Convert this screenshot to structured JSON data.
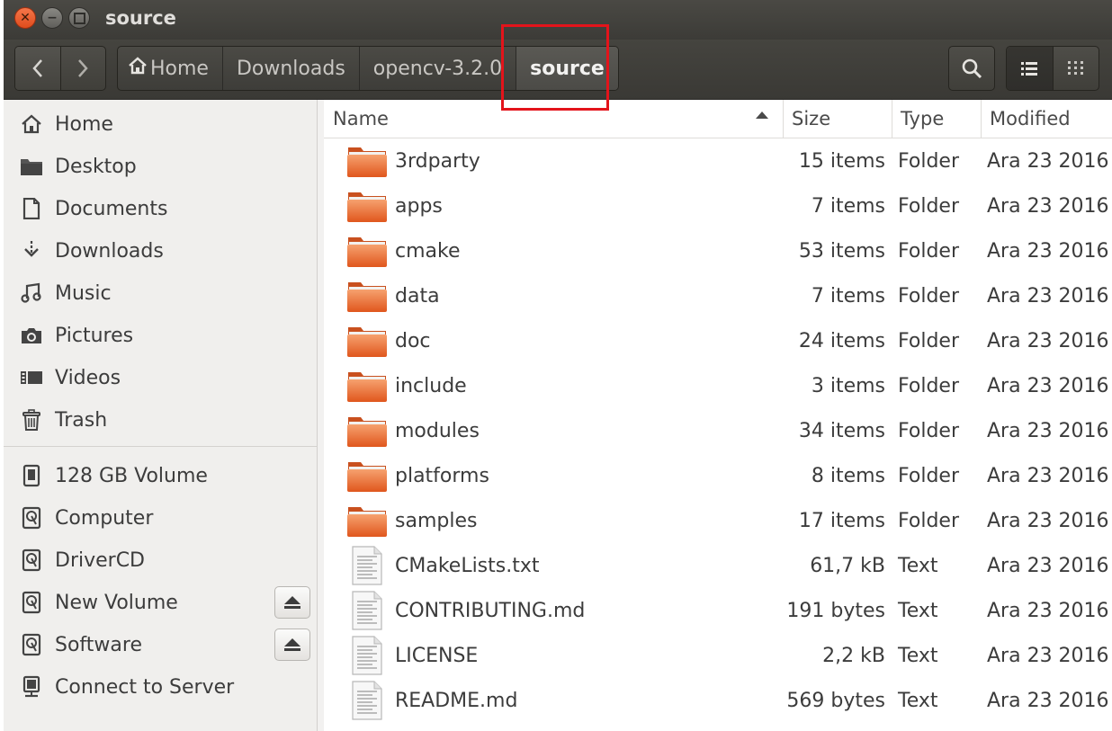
{
  "window": {
    "title": "source"
  },
  "breadcrumbs": [
    {
      "label": "Home",
      "active": false
    },
    {
      "label": "Downloads",
      "active": false
    },
    {
      "label": "opencv-3.2.0",
      "active": false
    },
    {
      "label": "source",
      "active": true
    }
  ],
  "sidebar": {
    "places": [
      {
        "label": "Home",
        "icon": "home-icon"
      },
      {
        "label": "Desktop",
        "icon": "desktop-folder-icon"
      },
      {
        "label": "Documents",
        "icon": "document-icon"
      },
      {
        "label": "Downloads",
        "icon": "download-icon"
      },
      {
        "label": "Music",
        "icon": "music-icon"
      },
      {
        "label": "Pictures",
        "icon": "camera-icon"
      },
      {
        "label": "Videos",
        "icon": "video-icon"
      },
      {
        "label": "Trash",
        "icon": "trash-icon"
      }
    ],
    "devices": [
      {
        "label": "128 GB Volume",
        "icon": "chip-drive-icon",
        "eject": false
      },
      {
        "label": "Computer",
        "icon": "disk-icon",
        "eject": false
      },
      {
        "label": "DriverCD",
        "icon": "disk-icon",
        "eject": false
      },
      {
        "label": "New Volume",
        "icon": "disk-icon",
        "eject": true
      },
      {
        "label": "Software",
        "icon": "disk-icon",
        "eject": true
      },
      {
        "label": "Connect to Server",
        "icon": "server-icon",
        "eject": false
      }
    ]
  },
  "columns": {
    "name": "Name",
    "size": "Size",
    "type": "Type",
    "modified": "Modified"
  },
  "files": [
    {
      "name": "3rdparty",
      "size": "15 items",
      "type": "Folder",
      "modified": "Ara 23 2016",
      "kind": "folder"
    },
    {
      "name": "apps",
      "size": "7 items",
      "type": "Folder",
      "modified": "Ara 23 2016",
      "kind": "folder"
    },
    {
      "name": "cmake",
      "size": "53 items",
      "type": "Folder",
      "modified": "Ara 23 2016",
      "kind": "folder"
    },
    {
      "name": "data",
      "size": "7 items",
      "type": "Folder",
      "modified": "Ara 23 2016",
      "kind": "folder"
    },
    {
      "name": "doc",
      "size": "24 items",
      "type": "Folder",
      "modified": "Ara 23 2016",
      "kind": "folder"
    },
    {
      "name": "include",
      "size": "3 items",
      "type": "Folder",
      "modified": "Ara 23 2016",
      "kind": "folder"
    },
    {
      "name": "modules",
      "size": "34 items",
      "type": "Folder",
      "modified": "Ara 23 2016",
      "kind": "folder"
    },
    {
      "name": "platforms",
      "size": "8 items",
      "type": "Folder",
      "modified": "Ara 23 2016",
      "kind": "folder"
    },
    {
      "name": "samples",
      "size": "17 items",
      "type": "Folder",
      "modified": "Ara 23 2016",
      "kind": "folder"
    },
    {
      "name": "CMakeLists.txt",
      "size": "61,7 kB",
      "type": "Text",
      "modified": "Ara 23 2016",
      "kind": "text"
    },
    {
      "name": "CONTRIBUTING.md",
      "size": "191 bytes",
      "type": "Text",
      "modified": "Ara 23 2016",
      "kind": "text"
    },
    {
      "name": "LICENSE",
      "size": "2,2 kB",
      "type": "Text",
      "modified": "Ara 23 2016",
      "kind": "text"
    },
    {
      "name": "README.md",
      "size": "569 bytes",
      "type": "Text",
      "modified": "Ara 23 2016",
      "kind": "text"
    }
  ],
  "colors": {
    "folder_top": "#f6a16f",
    "folder_bottom": "#e0561d",
    "highlight": "#e3141b"
  }
}
